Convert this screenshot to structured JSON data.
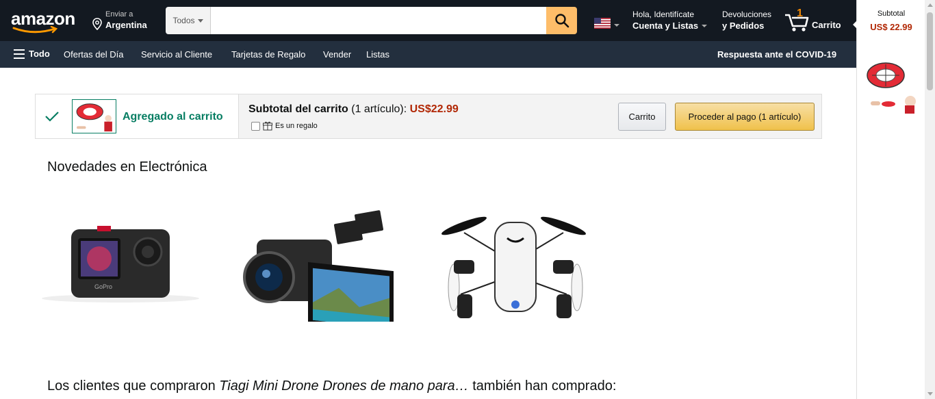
{
  "header": {
    "logo": "amazon",
    "deliver_line1": "Enviar a",
    "deliver_line2": "Argentina",
    "search_category": "Todos",
    "search_placeholder": "",
    "account_line1": "Hola, Identifícate",
    "account_line2": "Cuenta y Listas",
    "returns_line1": "Devoluciones",
    "returns_line2": "y Pedidos",
    "cart_count": "1",
    "cart_label": "Carrito"
  },
  "subnav": {
    "all": "Todo",
    "items": [
      "Ofertas del Día",
      "Servicio al Cliente",
      "Tarjetas de Regalo",
      "Vender",
      "Listas"
    ],
    "covid": "Respuesta ante el COVID-19"
  },
  "rail": {
    "subtotal_label": "Subtotal",
    "subtotal_value": "US$ 22.99"
  },
  "added": {
    "status": "Agregado al carrito",
    "subtotal_label": "Subtotal del carrito",
    "subtotal_count": "(1 artículo):",
    "subtotal_price": "US$22.99",
    "gift_label": "Es un regalo",
    "cart_button": "Carrito",
    "checkout_button": "Proceder al pago (1 artículo)"
  },
  "section": {
    "title": "Novedades en Electrónica"
  },
  "also_bought": {
    "prefix": "Los clientes que compraron ",
    "product": "Tiagi Mini Drone Drones de mano para…",
    "suffix": " también han comprado:"
  },
  "colors": {
    "nav_dark": "#131921",
    "nav_sub": "#232f3e",
    "search_btn": "#febd69",
    "price_red": "#b12704",
    "success_green": "#067d62",
    "cart_orange": "#f08804"
  }
}
